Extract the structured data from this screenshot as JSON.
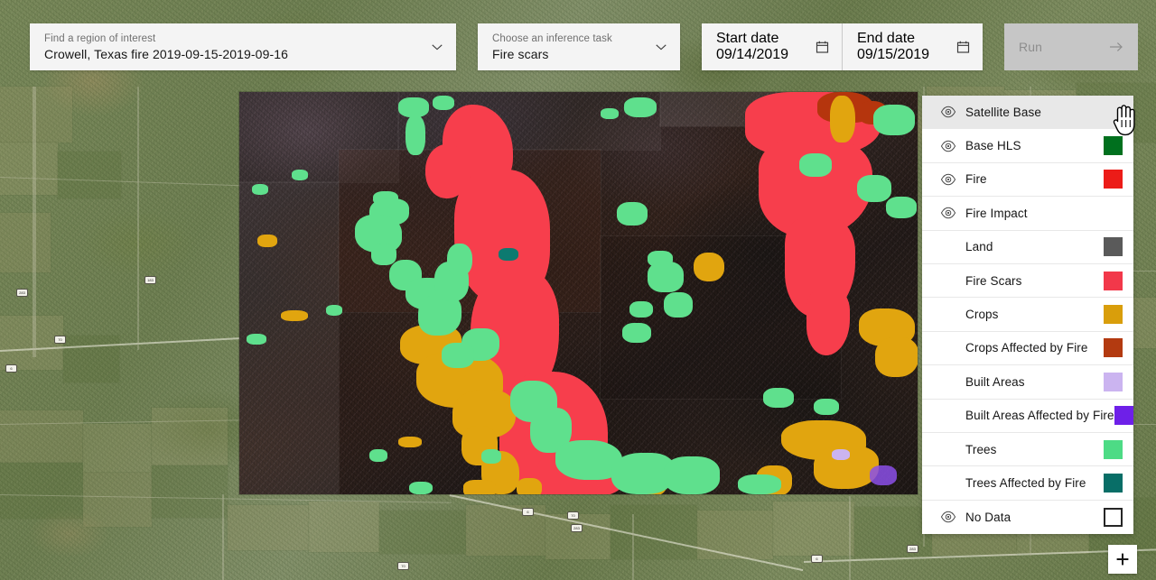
{
  "toolbar": {
    "roi": {
      "label": "Find a region of interest",
      "value": "Crowell, Texas fire 2019-09-15-2019-09-16",
      "icon": "chevron-down-icon"
    },
    "task": {
      "label": "Choose an inference task",
      "value": "Fire scars",
      "icon": "chevron-down-icon"
    },
    "start_date": {
      "label": "Start date",
      "value": "09/14/2019",
      "icon": "calendar-icon"
    },
    "end_date": {
      "label": "End date",
      "value": "09/15/2019",
      "icon": "calendar-icon"
    },
    "run": {
      "label": "Run",
      "icon": "arrow-right-icon",
      "enabled": false,
      "bg": "#c6c6c6",
      "fg": "#8d8d8d"
    }
  },
  "legend": {
    "rows": [
      {
        "name": "Satellite Base",
        "eye": true,
        "swatch": null,
        "indent": false,
        "active": true
      },
      {
        "name": "Base HLS",
        "eye": true,
        "swatch": "#00701e",
        "indent": false,
        "active": false
      },
      {
        "name": "Fire",
        "eye": true,
        "swatch": "#ec1c18",
        "indent": false,
        "active": false
      },
      {
        "name": "Fire Impact",
        "eye": true,
        "swatch": null,
        "indent": false,
        "active": false
      },
      {
        "name": "Land",
        "eye": false,
        "swatch": "#5a5a5a",
        "indent": true,
        "active": false
      },
      {
        "name": "Fire Scars",
        "eye": false,
        "swatch": "#f2384a",
        "indent": true,
        "active": false
      },
      {
        "name": "Crops",
        "eye": false,
        "swatch": "#d99e0b",
        "indent": true,
        "active": false
      },
      {
        "name": "Crops Affected by Fire",
        "eye": false,
        "swatch": "#b33a10",
        "indent": true,
        "active": false
      },
      {
        "name": "Built Areas",
        "eye": false,
        "swatch": "#cbb4f0",
        "indent": true,
        "active": false
      },
      {
        "name": "Built Areas Affected by Fire",
        "eye": false,
        "swatch": "#6e20e8",
        "indent": true,
        "active": false
      },
      {
        "name": "Trees",
        "eye": false,
        "swatch": "#4ddb85",
        "indent": true,
        "active": false
      },
      {
        "name": "Trees Affected by Fire",
        "eye": false,
        "swatch": "#086e67",
        "indent": true,
        "active": false
      },
      {
        "name": "No Data",
        "eye": true,
        "swatch": "outline",
        "indent": false,
        "active": false
      }
    ]
  },
  "map": {
    "zoom_in_label": "+",
    "route_markers": [
      "283",
      "6",
      "70",
      "183",
      "6",
      "70",
      "283",
      "70"
    ],
    "cursor": "pointer-hand-cursor"
  }
}
